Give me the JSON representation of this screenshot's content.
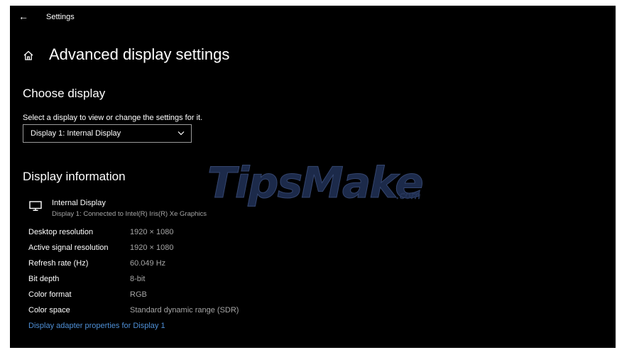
{
  "window": {
    "app_title": "Settings"
  },
  "header": {
    "page_title": "Advanced display settings"
  },
  "choose_display": {
    "section_title": "Choose display",
    "select_label": "Select a display to view or change the settings for it.",
    "dropdown_value": "Display 1: Internal Display"
  },
  "display_information": {
    "section_title": "Display information",
    "display_name": "Internal Display",
    "display_subtitle": "Display 1: Connected to Intel(R) Iris(R) Xe Graphics",
    "rows": [
      {
        "label": "Desktop resolution",
        "value": "1920 × 1080"
      },
      {
        "label": "Active signal resolution",
        "value": "1920 × 1080"
      },
      {
        "label": "Refresh rate (Hz)",
        "value": "60.049 Hz"
      },
      {
        "label": "Bit depth",
        "value": "8-bit"
      },
      {
        "label": "Color format",
        "value": "RGB"
      },
      {
        "label": "Color space",
        "value": "Standard dynamic range (SDR)"
      }
    ],
    "adapter_link": "Display adapter properties for Display 1"
  },
  "watermark": {
    "text": "TipsMake.com"
  },
  "icons": {
    "back": "back-arrow-icon",
    "home": "home-icon",
    "chevron": "chevron-down-icon",
    "monitor": "monitor-icon"
  },
  "colors": {
    "window_bg": "#000000",
    "link": "#4e8fd6",
    "secondary_text": "#a6a6a6"
  }
}
